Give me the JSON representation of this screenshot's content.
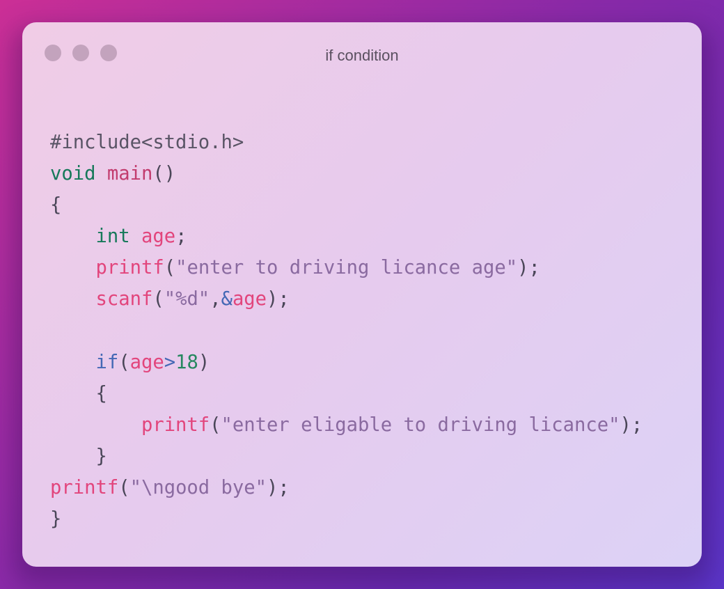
{
  "window": {
    "title": "if condition"
  },
  "colors": {
    "background_start": "#cc2f96",
    "background_end": "#5a35c8",
    "window_bg": "#ebcceb",
    "dot": "#c3a3bd",
    "keyword": "#17795a",
    "function": "#c23c6e",
    "call": "#e2457c",
    "string": "#8a6aa0",
    "operator": "#4468b5",
    "number": "#26875f"
  },
  "code": {
    "language": "c",
    "lines": [
      {
        "tokens": [
          {
            "t": "#include<stdio.h>",
            "k": "pre"
          }
        ]
      },
      {
        "tokens": [
          {
            "t": "void",
            "k": "kw"
          },
          {
            "t": " ",
            "k": "punc"
          },
          {
            "t": "main",
            "k": "fn"
          },
          {
            "t": "()",
            "k": "punc"
          }
        ]
      },
      {
        "tokens": [
          {
            "t": "{",
            "k": "punc"
          }
        ]
      },
      {
        "tokens": [
          {
            "t": "    ",
            "k": "punc"
          },
          {
            "t": "int",
            "k": "kw"
          },
          {
            "t": " ",
            "k": "punc"
          },
          {
            "t": "age",
            "k": "var"
          },
          {
            "t": ";",
            "k": "punc"
          }
        ]
      },
      {
        "tokens": [
          {
            "t": "    ",
            "k": "punc"
          },
          {
            "t": "printf",
            "k": "call"
          },
          {
            "t": "(",
            "k": "punc"
          },
          {
            "t": "\"enter to driving licance age\"",
            "k": "str"
          },
          {
            "t": ");",
            "k": "punc"
          }
        ]
      },
      {
        "tokens": [
          {
            "t": "    ",
            "k": "punc"
          },
          {
            "t": "scanf",
            "k": "call"
          },
          {
            "t": "(",
            "k": "punc"
          },
          {
            "t": "\"%d\"",
            "k": "str"
          },
          {
            "t": ",",
            "k": "punc"
          },
          {
            "t": "&",
            "k": "op"
          },
          {
            "t": "age",
            "k": "var"
          },
          {
            "t": ");",
            "k": "punc"
          }
        ]
      },
      {
        "tokens": [
          {
            "t": "",
            "k": "punc"
          }
        ]
      },
      {
        "tokens": [
          {
            "t": "    ",
            "k": "punc"
          },
          {
            "t": "if",
            "k": "op"
          },
          {
            "t": "(",
            "k": "punc"
          },
          {
            "t": "age",
            "k": "var"
          },
          {
            "t": ">",
            "k": "op"
          },
          {
            "t": "18",
            "k": "num"
          },
          {
            "t": ")",
            "k": "punc"
          }
        ]
      },
      {
        "tokens": [
          {
            "t": "    ",
            "k": "punc"
          },
          {
            "t": "{",
            "k": "punc"
          }
        ]
      },
      {
        "tokens": [
          {
            "t": "        ",
            "k": "punc"
          },
          {
            "t": "printf",
            "k": "call"
          },
          {
            "t": "(",
            "k": "punc"
          },
          {
            "t": "\"enter eligable to driving licance\"",
            "k": "str"
          },
          {
            "t": ");",
            "k": "punc"
          }
        ]
      },
      {
        "tokens": [
          {
            "t": "    ",
            "k": "punc"
          },
          {
            "t": "}",
            "k": "punc"
          }
        ]
      },
      {
        "tokens": [
          {
            "t": "printf",
            "k": "call"
          },
          {
            "t": "(",
            "k": "punc"
          },
          {
            "t": "\"\\ngood bye\"",
            "k": "str"
          },
          {
            "t": ");",
            "k": "punc"
          }
        ]
      },
      {
        "tokens": [
          {
            "t": "}",
            "k": "punc"
          }
        ]
      }
    ]
  }
}
